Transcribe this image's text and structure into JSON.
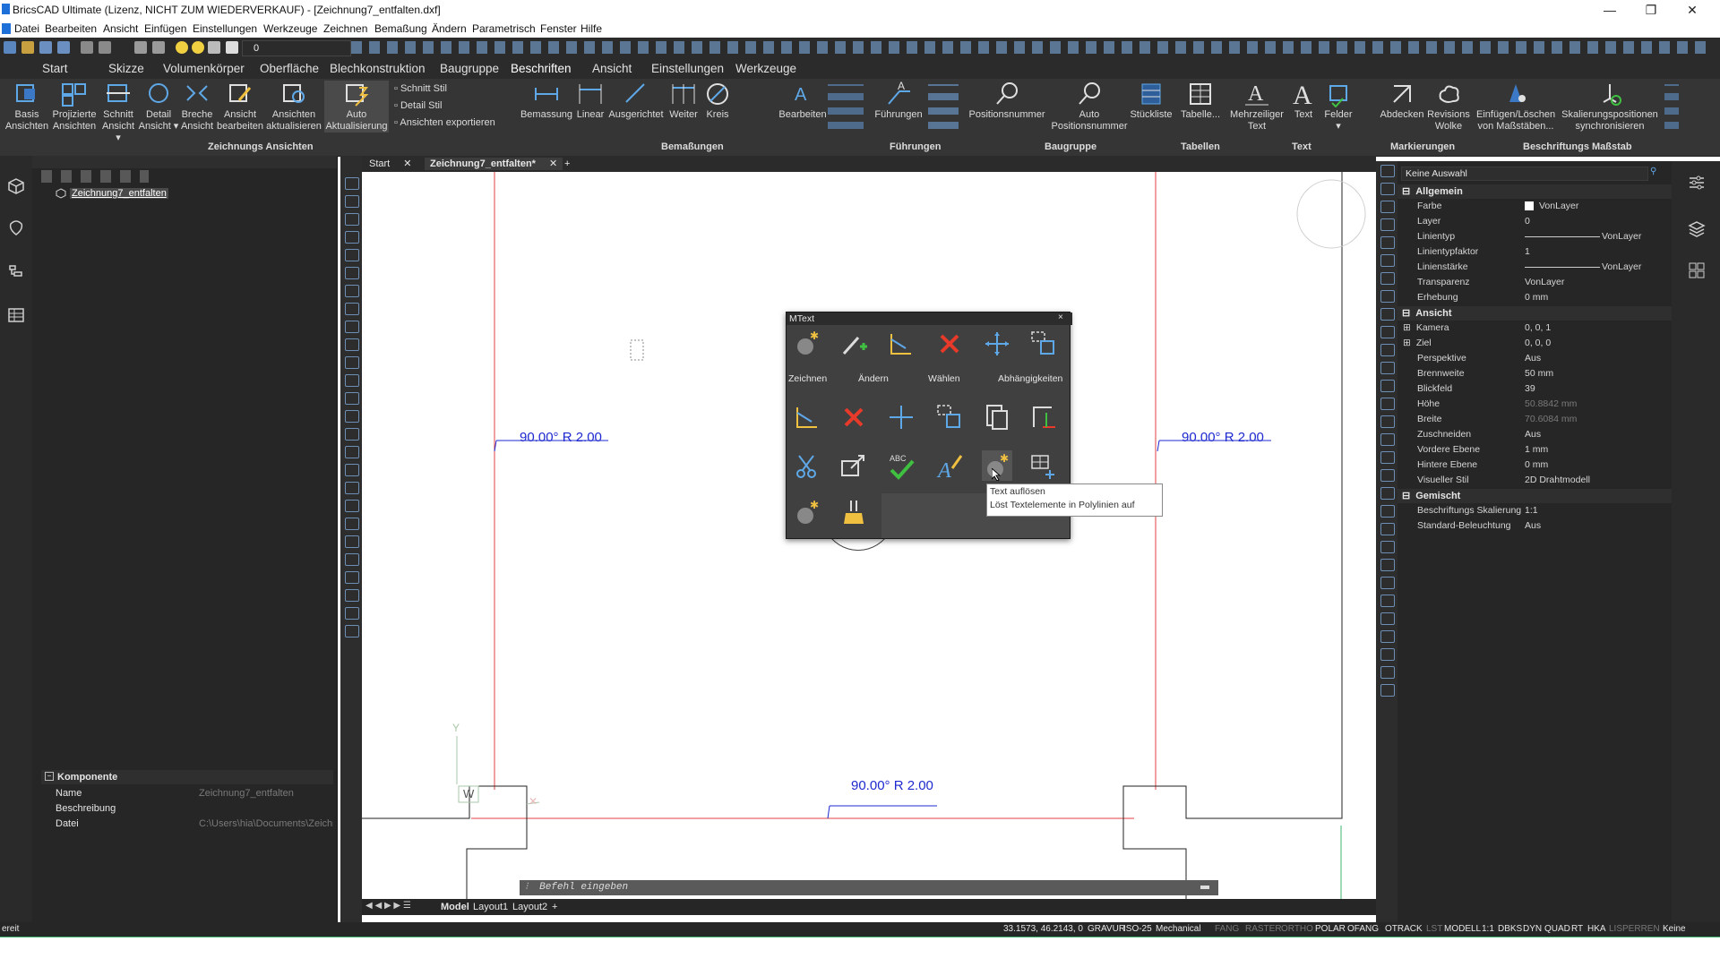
{
  "window": {
    "title": "BricsCAD Ultimate (Lizenz, NICHT ZUM WIEDERVERKAUF) - [Zeichnung7_entfalten.dxf]",
    "minimize": "—",
    "restore": "❐",
    "close": "✕"
  },
  "menu": [
    "Datei",
    "Bearbeiten",
    "Ansicht",
    "Einfügen",
    "Einstellungen",
    "Werkzeuge",
    "Zeichnen",
    "Bemaßung",
    "Ändern",
    "Parametrisch",
    "Fenster",
    "Hilfe"
  ],
  "quick_toolbar": {
    "layer_value": "0"
  },
  "ribbon_tabs": [
    "Start",
    "Skizze",
    "Volumenkörper",
    "Oberfläche",
    "Blechkonstruktion",
    "Baugruppe",
    "Beschriften",
    "Ansicht",
    "Einstellungen",
    "Werkzeuge"
  ],
  "active_tab": "Beschriften",
  "ribbon": {
    "zeichnungs_ansichten": {
      "group": "Zeichnungs Ansichten",
      "buttons": [
        {
          "l1": "Basis",
          "l2": "Ansichten"
        },
        {
          "l1": "Projizierte",
          "l2": "Ansichten"
        },
        {
          "l1": "Schnitt",
          "l2": "Ansicht ▾"
        },
        {
          "l1": "Detail",
          "l2": "Ansicht ▾"
        },
        {
          "l1": "Breche",
          "l2": "Ansicht"
        },
        {
          "l1": "Ansicht",
          "l2": "bearbeiten"
        },
        {
          "l1": "Ansichten",
          "l2": "aktualisieren"
        },
        {
          "l1": "Auto",
          "l2": "Aktualisierung"
        }
      ],
      "small": [
        "Schnitt Stil",
        "Detail Stil",
        "Ansichten exportieren"
      ]
    },
    "bemassungen": {
      "group": "Bemaßungen",
      "buttons": [
        "Bemassung",
        "Linear",
        "Ausgerichtet",
        "Weiter",
        "Kreis",
        "Bearbeiten"
      ]
    },
    "fuehrungen": {
      "group": "Führungen",
      "buttons": [
        "Führungen"
      ]
    },
    "baugruppe": {
      "group": "Baugruppe",
      "buttons": [
        "Positionsnummer",
        "Auto Positionsnummer"
      ]
    },
    "tabellen": {
      "group": "Tabellen",
      "buttons": [
        "Stückliste",
        "Tabelle..."
      ]
    },
    "text": {
      "group": "Text",
      "buttons": [
        {
          "l1": "Mehrzeiliger",
          "l2": "Text"
        },
        {
          "l1": "Text",
          "l2": ""
        },
        {
          "l1": "Felder",
          "l2": "▾"
        }
      ]
    },
    "markierungen": {
      "group": "Markierungen",
      "buttons": [
        {
          "l1": "Abdecken",
          "l2": ""
        },
        {
          "l1": "Revisions",
          "l2": "Wolke"
        }
      ]
    },
    "beschriftungs_massstab": {
      "group": "Beschriftungs Maßstab",
      "buttons": [
        {
          "l1": "Einfügen/Löschen",
          "l2": "von Maßstäben..."
        },
        {
          "l1": "Skalierungspositionen",
          "l2": "synchronisieren"
        }
      ]
    }
  },
  "left_panel": {
    "tree_root": "Zeichnung7_entfalten",
    "component_section": "Komponente",
    "rows": [
      {
        "label": "Name",
        "value": "Zeichnung7_entfalten"
      },
      {
        "label": "Beschreibung",
        "value": ""
      },
      {
        "label": "Datei",
        "value": "C:\\Users\\hia\\Documents\\Zeichnun"
      }
    ]
  },
  "doc_tabs": [
    {
      "label": "Start"
    },
    {
      "label": "Zeichnung7_entfalten*"
    }
  ],
  "canvas": {
    "dim_labels": [
      "90.00° R 2.00",
      "90.00° R 2.00",
      "90.00° R 2.00"
    ],
    "ucs_y": "Y",
    "ucs_w": "W"
  },
  "mtext_panel": {
    "title": "MText",
    "close": "×",
    "row_labels": [
      "Zeichnen",
      "Ändern",
      "Wählen",
      "Abhängigkeiten"
    ],
    "tooltip_title": "Text auflösen",
    "tooltip_desc": "Löst Textelemente in Polylinien auf"
  },
  "command_line": {
    "placeholder": "Befehl eingeben"
  },
  "layout_tabs": [
    "Model",
    "Layout1",
    "Layout2",
    "+"
  ],
  "properties": {
    "selection": "Keine Auswahl",
    "sections": {
      "allgemein": {
        "title": "Allgemein",
        "rows": [
          {
            "label": "Farbe",
            "value": "VonLayer"
          },
          {
            "label": "Layer",
            "value": "0"
          },
          {
            "label": "Linientyp",
            "value": "VonLayer"
          },
          {
            "label": "Linientypfaktor",
            "value": "1"
          },
          {
            "label": "Linienstärke",
            "value": "VonLayer"
          },
          {
            "label": "Transparenz",
            "value": "VonLayer"
          },
          {
            "label": "Erhebung",
            "value": "0 mm"
          }
        ]
      },
      "ansicht": {
        "title": "Ansicht",
        "rows": [
          {
            "label": "Kamera",
            "value": "0, 0, 1"
          },
          {
            "label": "Ziel",
            "value": "0, 0, 0"
          },
          {
            "label": "Perspektive",
            "value": "Aus"
          },
          {
            "label": "Brennweite",
            "value": "50 mm"
          },
          {
            "label": "Blickfeld",
            "value": "39"
          },
          {
            "label": "Höhe",
            "value": "50.8842 mm"
          },
          {
            "label": "Breite",
            "value": "70.6084 mm"
          },
          {
            "label": "Zuschneiden",
            "value": "Aus"
          },
          {
            "label": "Vordere Ebene",
            "value": "1 mm"
          },
          {
            "label": "Hintere Ebene",
            "value": "0 mm"
          },
          {
            "label": "Visueller Stil",
            "value": "2D Drahtmodell"
          }
        ]
      },
      "gemischt": {
        "title": "Gemischt",
        "rows": [
          {
            "label": "Beschriftungs Skalierung",
            "value": "1:1"
          },
          {
            "label": "Standard-Beleuchtung",
            "value": "Aus"
          }
        ]
      }
    }
  },
  "status": {
    "left": "ereit",
    "coords": "33.1573, 46.2143, 0",
    "items": [
      "GRAVUR",
      "ISO-25",
      "Mechanical",
      "FANG",
      "RASTER",
      "ORTHO",
      "POLAR",
      "OFANG",
      "OTRACK",
      "LST",
      "MODELL",
      "1:1",
      "DBKS",
      "DYN",
      "QUAD",
      "RT",
      "HKA",
      "LISPERREN",
      "Keine"
    ]
  },
  "colors": {
    "accent": "#1c6fd6",
    "dim_text": "#1e2ad0",
    "red_line": "#e04040"
  }
}
